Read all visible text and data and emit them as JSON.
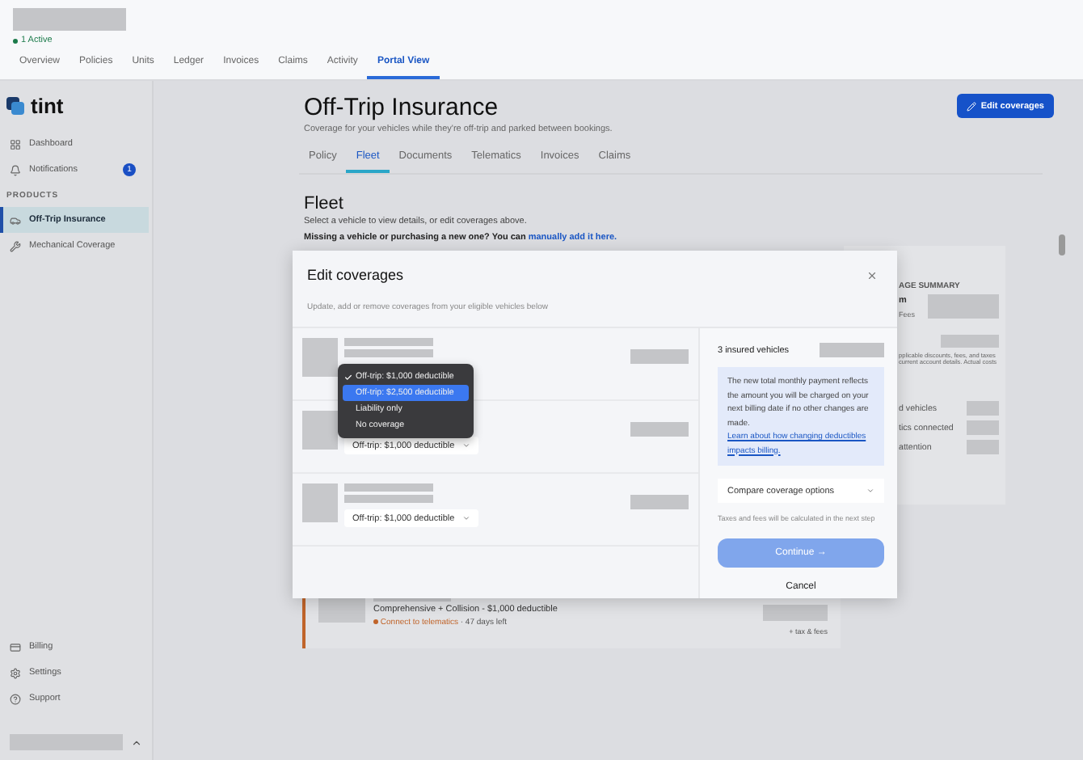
{
  "header": {
    "status": "1 Active",
    "tabs": [
      {
        "label": "Overview",
        "selected": false
      },
      {
        "label": "Policies",
        "selected": false
      },
      {
        "label": "Units",
        "selected": false
      },
      {
        "label": "Ledger",
        "selected": false
      },
      {
        "label": "Invoices",
        "selected": false
      },
      {
        "label": "Claims",
        "selected": false
      },
      {
        "label": "Activity",
        "selected": false
      },
      {
        "label": "Portal View",
        "selected": true
      }
    ]
  },
  "sidebar": {
    "logo": "tint",
    "items": [
      {
        "label": "Dashboard",
        "selected": false
      },
      {
        "label": "Notifications",
        "selected": false,
        "badge": "1"
      }
    ],
    "section": "PRODUCTS",
    "products": [
      {
        "label": "Off-Trip Insurance",
        "selected": true
      },
      {
        "label": "Mechanical Coverage",
        "selected": false
      }
    ],
    "footer_items": [
      {
        "label": "Billing",
        "selected": false
      },
      {
        "label": "Settings",
        "selected": false
      },
      {
        "label": "Support",
        "selected": false
      }
    ]
  },
  "page": {
    "title": "Off-Trip Insurance",
    "subtitle": "Coverage for your vehicles while they're off-trip and parked between bookings.",
    "edit_button": "Edit coverages",
    "tabs": [
      {
        "label": "Policy",
        "selected": false
      },
      {
        "label": "Fleet",
        "selected": true
      },
      {
        "label": "Documents",
        "selected": false
      },
      {
        "label": "Telematics",
        "selected": false
      },
      {
        "label": "Invoices",
        "selected": false
      },
      {
        "label": "Claims",
        "selected": false
      }
    ],
    "fleet": {
      "heading": "Fleet",
      "hint": "Select a vehicle to view details, or edit coverages above.",
      "missing_text": "Missing a vehicle or purchasing a new one? You can ",
      "missing_link": "manually add it here."
    },
    "summary": {
      "heading": "AGE SUMMARY",
      "line_1": "m",
      "line_2": "Fees",
      "note_1": "pplicable discounts, fees, and taxes",
      "note_2": "current account details. Actual costs",
      "stats": [
        "d vehicles",
        "tics connected",
        "attention"
      ]
    },
    "vehicle_card": {
      "coverage": "Comprehensive + Collision - $1,000 deductible",
      "alert_link": "Connect to telematics",
      "alert_rest": " · 47 days left",
      "price_note": "+ tax & fees"
    }
  },
  "modal": {
    "title": "Edit coverages",
    "subtitle": "Update, add or remove coverages from your eligible vehicles below",
    "vehicles": [
      {
        "menu": [
          {
            "label": "Off-trip: $1,000 deductible",
            "checked": true,
            "selected": false
          },
          {
            "label": "Off-trip: $2,500 deductible",
            "checked": false,
            "selected": true
          },
          {
            "label": "Liability only",
            "checked": false,
            "selected": false
          },
          {
            "label": "No coverage",
            "checked": false,
            "selected": false
          }
        ]
      },
      {
        "coverage": "Off-trip: $1,000 deductible"
      },
      {
        "coverage": "Off-trip: $1,000 deductible"
      }
    ],
    "insured": "3 insured vehicles",
    "info": "The new total monthly payment reflects the amount you will be charged on your next billing date if no other changes are made. ",
    "info_link": "Learn about how changing deductibles impacts billing.",
    "compare": "Compare coverage options",
    "tax_note": "Taxes and fees will be calculated in the next step",
    "continue": "Continue →",
    "continue_disabled": true,
    "cancel": "Cancel"
  }
}
